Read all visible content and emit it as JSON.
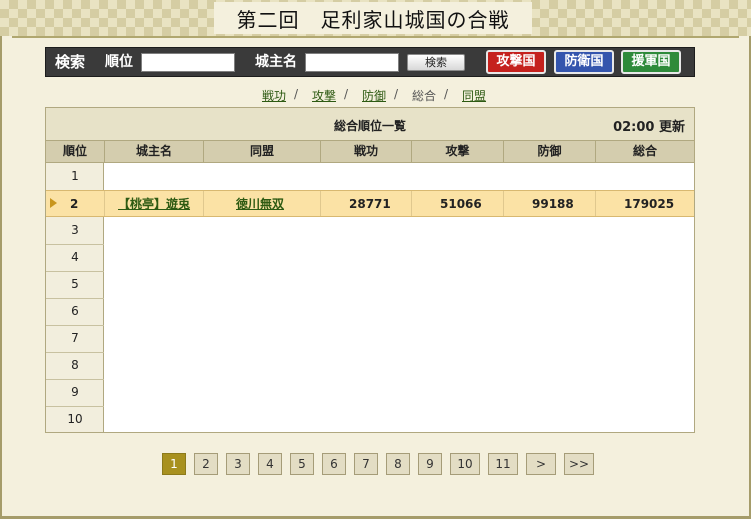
{
  "page": {
    "title": "第二回　足利家山城国の合戦"
  },
  "search": {
    "label": "検索",
    "rank_label": "順位",
    "rank_value": "",
    "lord_label": "城主名",
    "lord_value": "",
    "search_button": "検索",
    "attack_button": "攻撃国",
    "defense_button": "防衛国",
    "support_button": "援軍国"
  },
  "tabs": [
    {
      "label": "戦功",
      "current": false
    },
    {
      "label": "攻撃",
      "current": false
    },
    {
      "label": "防御",
      "current": false
    },
    {
      "label": "総合",
      "current": true
    },
    {
      "label": "同盟",
      "current": false
    }
  ],
  "tab_separator": "/",
  "table": {
    "title": "総合順位一覧",
    "update_time": "02:00",
    "update_label": "更新",
    "columns": [
      "順位",
      "城主名",
      "同盟",
      "戦功",
      "攻撃",
      "防御",
      "総合"
    ],
    "ranks": [
      "1",
      "2",
      "3",
      "4",
      "5",
      "6",
      "7",
      "8",
      "9",
      "10"
    ],
    "highlight_row": {
      "rank": "2",
      "lord": "【桃亭】遊兎",
      "alliance": "徳川無双",
      "merit": "28771",
      "attack": "51066",
      "defense": "99188",
      "total": "179025"
    }
  },
  "pagination": {
    "pages": [
      "1",
      "2",
      "3",
      "4",
      "5",
      "6",
      "7",
      "8",
      "9",
      "10",
      "11"
    ],
    "current": "1",
    "next": ">",
    "last": ">>"
  },
  "colors": {
    "background": "#f4f0dd",
    "attack": "#c5211d",
    "defense": "#3455ad",
    "support": "#2e8a3a",
    "highlight": "#fbe2a5",
    "link": "#2d5a12",
    "current_page": "#a8911f"
  },
  "icons": {
    "row_marker": "triangle-right-icon"
  }
}
